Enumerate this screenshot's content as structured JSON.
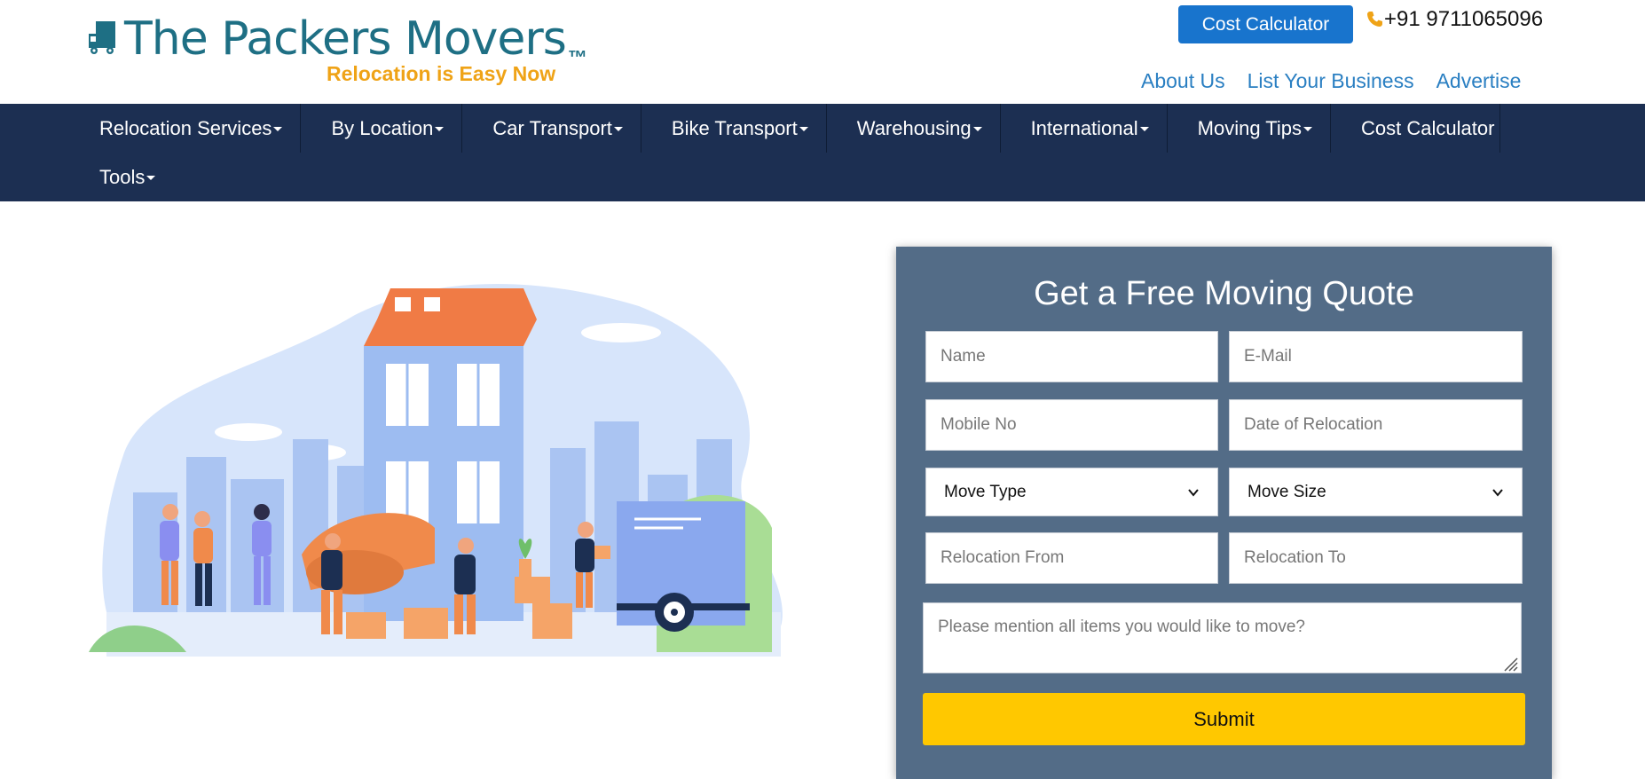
{
  "brand": {
    "name": "The Packers Movers",
    "trademark": "™",
    "tagline": "Relocation is Easy Now",
    "primary_color": "#1e6f84",
    "tagline_color": "#efa317"
  },
  "header": {
    "cost_button_label": "Cost Calculator",
    "phone_icon": "phone-icon",
    "phone_number": "+91 9711065096",
    "links": [
      "About Us",
      "List Your Business",
      "Advertise"
    ]
  },
  "nav": {
    "background": "#1c2f52",
    "items": [
      {
        "label": "Relocation Services",
        "dropdown": true
      },
      {
        "label": "By Location",
        "dropdown": true
      },
      {
        "label": "Car Transport",
        "dropdown": true
      },
      {
        "label": "Bike Transport",
        "dropdown": true
      },
      {
        "label": "Warehousing",
        "dropdown": true
      },
      {
        "label": "International",
        "dropdown": true
      },
      {
        "label": "Moving Tips",
        "dropdown": true
      },
      {
        "label": "Cost Calculator",
        "dropdown": false
      },
      {
        "label": "Tools",
        "dropdown": true
      }
    ]
  },
  "quote_form": {
    "title": "Get a Free Moving Quote",
    "name_placeholder": "Name",
    "email_placeholder": "E-Mail",
    "mobile_placeholder": "Mobile No",
    "date_placeholder": "Date of Relocation",
    "move_type_selected": "Move Type",
    "move_size_selected": "Move Size",
    "from_placeholder": "Relocation From",
    "to_placeholder": "Relocation To",
    "items_placeholder": "Please mention all items you would like to move?",
    "submit_label": "Submit",
    "panel_color": "#536c87",
    "submit_color": "#ffc800"
  },
  "hero": {
    "illustration": "moving-house-illustration"
  }
}
